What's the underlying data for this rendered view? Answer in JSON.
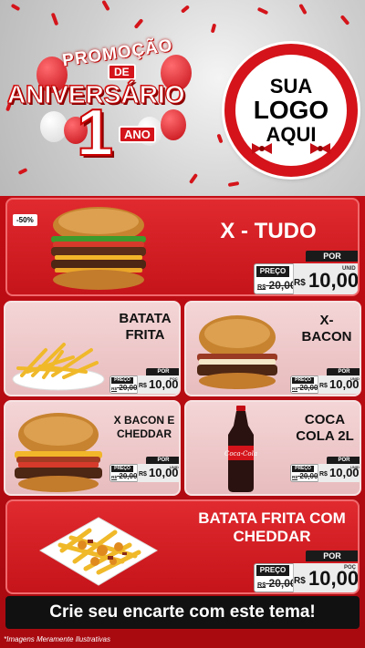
{
  "header": {
    "promo_word": "PROMOÇÃO",
    "promo_de": "DE",
    "promo_aniversario": "ANIVERSÁRIO",
    "promo_number": "1",
    "promo_ano": "ANO",
    "logo_line1": "SUA",
    "logo_line2": "LOGO",
    "logo_line3": "AQUI"
  },
  "products": [
    {
      "name": "X - TUDO",
      "badge": "-50%",
      "preco_label": "PREÇO",
      "por_label": "POR",
      "old_price": "20,00",
      "old_prefix": "R$",
      "currency": "R$",
      "new_price": "10,00",
      "unit": "UNID"
    },
    {
      "name_line1": "BATATA",
      "name_line2": "FRITA",
      "preco_label": "PREÇO",
      "por_label": "POR",
      "old_price": "20,00",
      "old_prefix": "R$",
      "currency": "R$",
      "new_price": "10,00",
      "unit": "POÇ"
    },
    {
      "name_line1": "X-",
      "name_line2": "BACON",
      "preco_label": "PREÇO",
      "por_label": "POR",
      "old_price": "20,00",
      "old_prefix": "R$",
      "currency": "R$",
      "new_price": "10,00",
      "unit": "UNID"
    },
    {
      "name_line1": "X BACON E",
      "name_line2": "CHEDDAR",
      "preco_label": "PREÇO",
      "por_label": "POR",
      "old_price": "20,00",
      "old_prefix": "R$",
      "currency": "R$",
      "new_price": "10,00",
      "unit": "UNID"
    },
    {
      "name_line1": "COCA",
      "name_line2": "COLA 2L",
      "preco_label": "PREÇO",
      "por_label": "POR",
      "old_price": "20,00",
      "old_prefix": "R$",
      "currency": "R$",
      "new_price": "10,00",
      "unit": "UNID"
    },
    {
      "name_line1": "BATATA FRITA COM",
      "name_line2": "CHEDDAR",
      "preco_label": "PREÇO",
      "por_label": "POR",
      "old_price": "20,00",
      "old_prefix": "R$",
      "currency": "R$",
      "new_price": "10,00",
      "unit": "POÇ"
    }
  ],
  "coke_label": "Coca-Cola",
  "cta": "Crie seu encarte com este tema!",
  "disclaimer": "*Imagens Meramente Ilustrativas",
  "colors": {
    "brand_red": "#d4141a",
    "dark_red": "#a80a10",
    "tag_black": "#1a1a1a"
  }
}
